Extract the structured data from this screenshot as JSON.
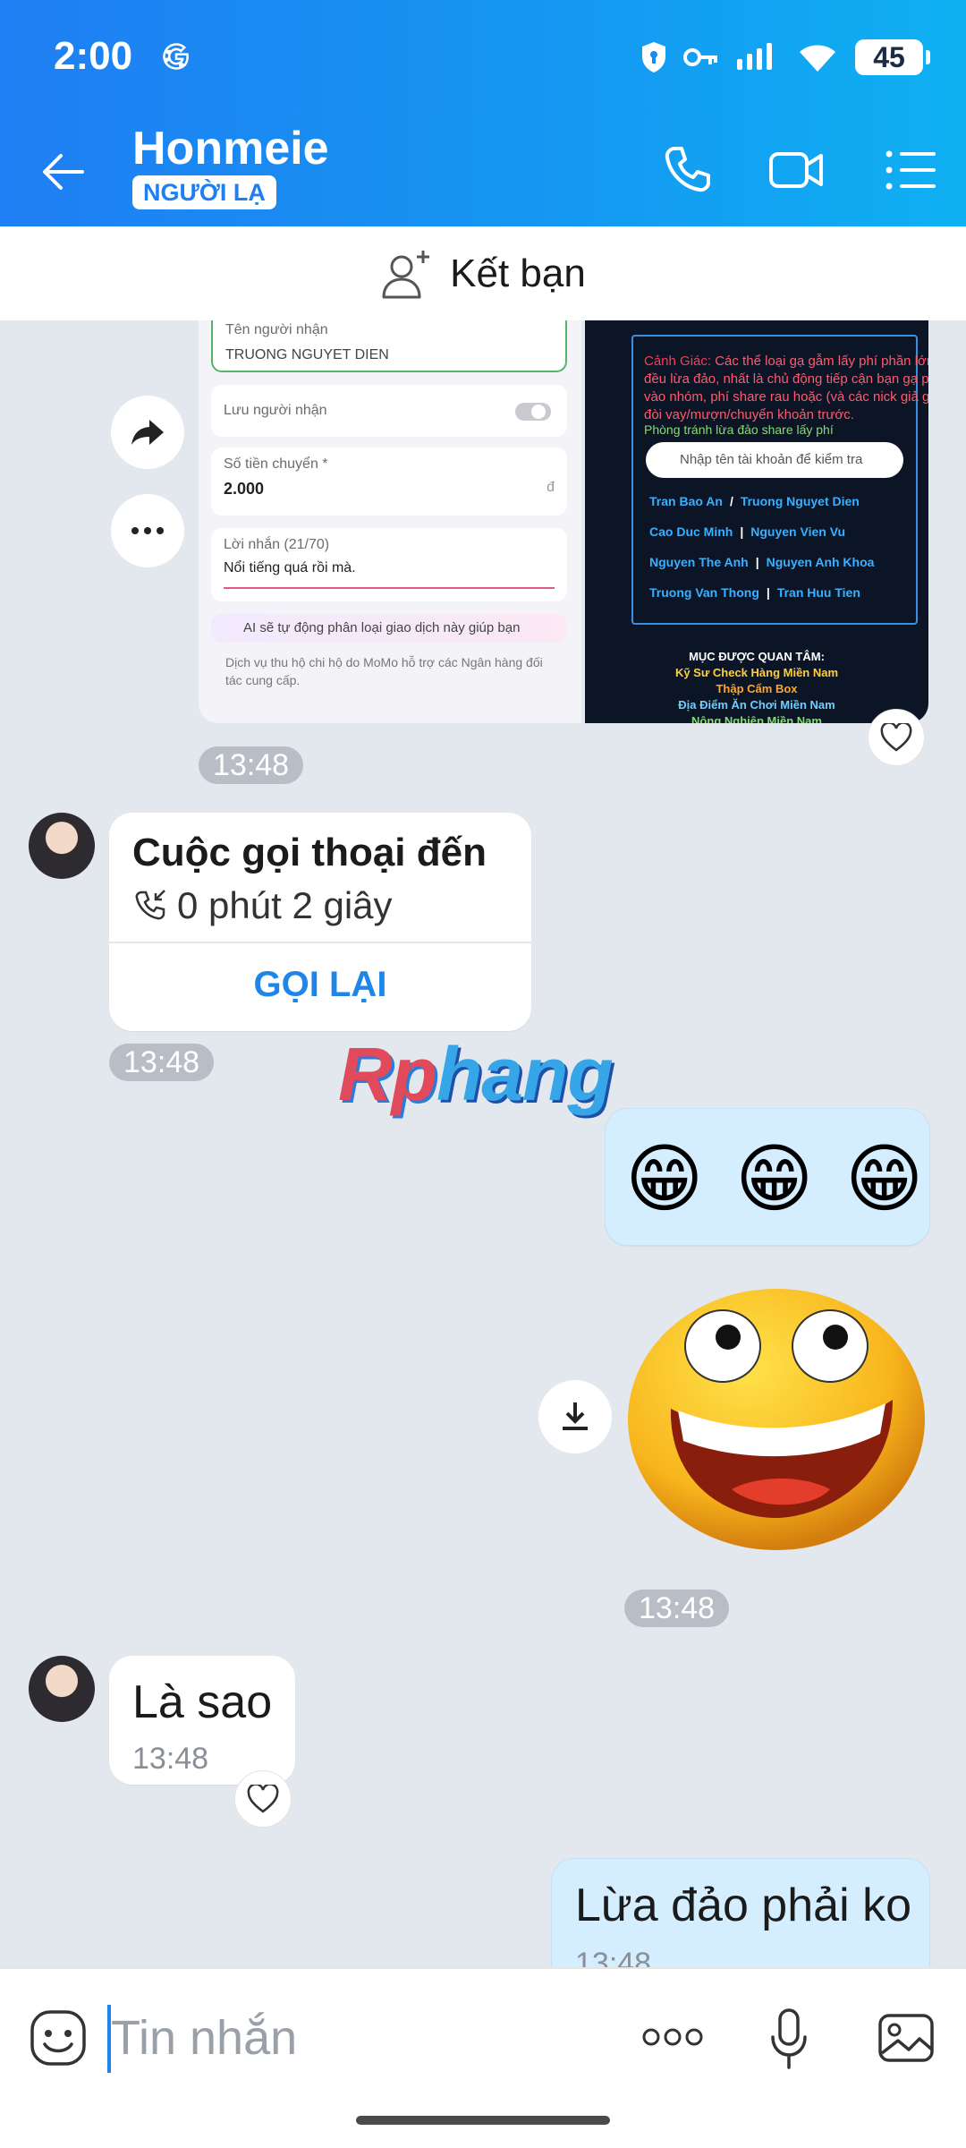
{
  "status": {
    "time": "2:00",
    "battery": "45"
  },
  "header": {
    "name": "Honmeie",
    "badge": "NGƯỜI LẠ"
  },
  "friend_bar": {
    "label": "Kết bạn"
  },
  "shared_image": {
    "left": {
      "recipient_label": "Tên người nhận",
      "recipient_value": "TRUONG NGUYET DIEN",
      "save_label": "Lưu người nhận",
      "amount_label": "Số tiền chuyển *",
      "amount_value": "2.000",
      "currency": "đ",
      "message_label": "Lời nhắn (21/70)",
      "message_value": "Nổi tiếng quá rồi mà.",
      "ai_note": "AI sẽ tự động phân loại giao dịch này giúp bạn",
      "footer_note": "Dịch vụ thu hộ chi hộ do MoMo hỗ trợ các Ngân hàng đối tác cung cấp."
    },
    "right": {
      "warning_title": "Cảnh Giác:",
      "warning_text": "Các thể loại gạ gẫm lấy phí phần lớn đều lừa đảo, nhất là chủ động tiếp cận bạn gạ phí vào nhóm, phí share rau hoặc (và các nick giả gái) đòi vay/mượn/chuyển khoản trước.",
      "warning_tip": "Phòng tránh lừa đảo share lấy phí",
      "search_placeholder": "Nhập tên tài khoản để kiểm tra",
      "names": [
        [
          "Tran Bao An",
          "Truong Nguyet Dien"
        ],
        [
          "Cao Duc Minh",
          "Nguyen Vien Vu"
        ],
        [
          "Nguyen The Anh",
          "Nguyen Anh Khoa"
        ],
        [
          "Truong Van Thong",
          "Tran Huu Tien"
        ]
      ],
      "interest_title": "MỤC ĐƯỢC QUAN TÂM:",
      "interests": [
        "Kỹ Sư Check Hàng Miền Nam",
        "Thập Cẩm Box",
        "Địa Điểm Ăn Chơi Miền Nam",
        "Nông Nghiệp Miền Nam"
      ]
    }
  },
  "messages": {
    "time_1": "13:48",
    "call": {
      "title": "Cuộc gọi thoại đến",
      "duration": "0 phút 2 giây",
      "action": "GỌI LẠI",
      "time": "13:48"
    },
    "emoji_msg": "😁 😁 😁",
    "time_2": "13:48",
    "reply_1": {
      "text": "Là sao",
      "time": "13:48"
    },
    "reply_2": {
      "text": "Lừa đảo phải ko",
      "time": "13:48"
    }
  },
  "watermark": {
    "part1": "Rp",
    "part2": "hang"
  },
  "input": {
    "placeholder": "Tin nhắn"
  }
}
